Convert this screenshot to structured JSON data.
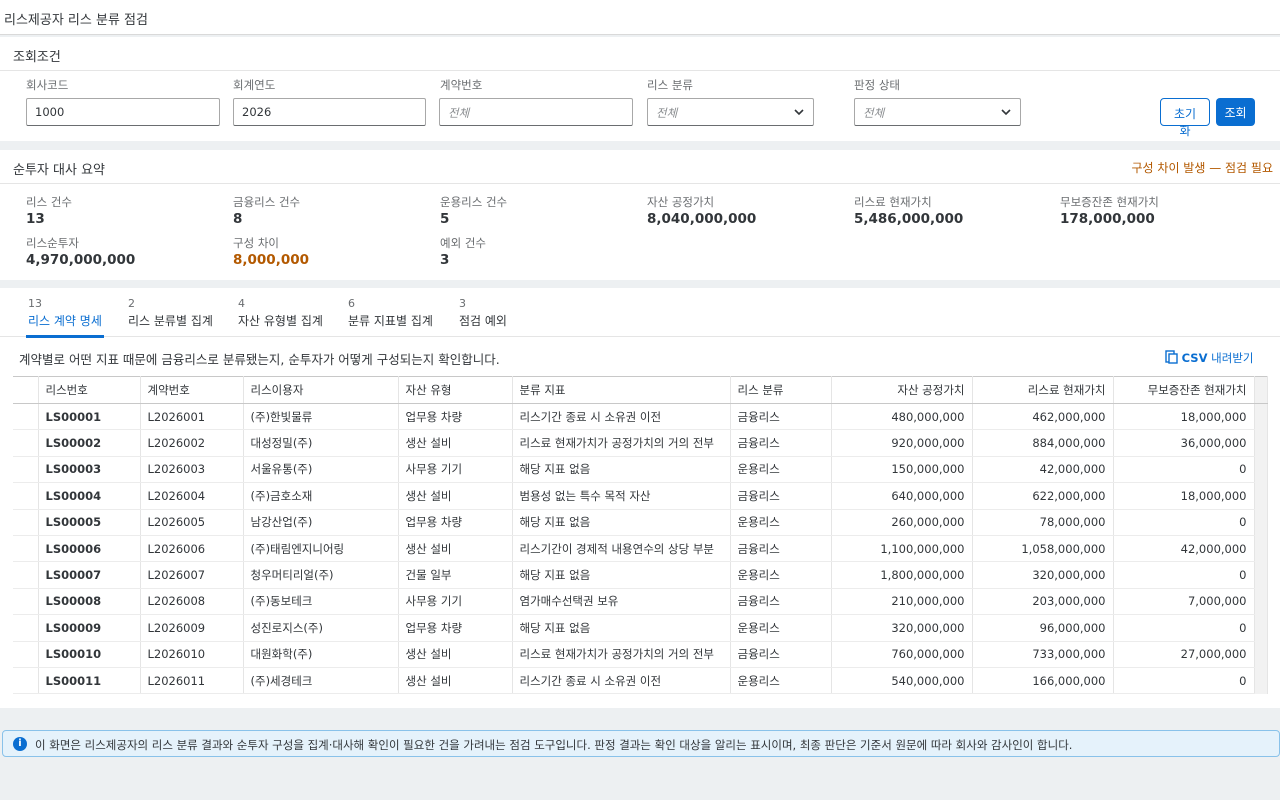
{
  "app": {
    "title": "리스제공자 리스 분류 점검"
  },
  "filters": {
    "section_title": "조회조건",
    "company_code": {
      "label": "회사코드",
      "value": "1000"
    },
    "fiscal_year": {
      "label": "회계연도",
      "value": "2026"
    },
    "contract_no": {
      "label": "계약번호",
      "placeholder": "전체"
    },
    "lease_class": {
      "label": "리스 분류",
      "value": "전체"
    },
    "judgment_status": {
      "label": "판정 상태",
      "value": "전체"
    },
    "reset_label": "초기화",
    "search_label": "조회"
  },
  "summary": {
    "title": "순투자 대사 요약",
    "alert": "구성 차이 발생 — 점검 필요",
    "items": [
      {
        "label": "리스 건수",
        "value": "13"
      },
      {
        "label": "금융리스 건수",
        "value": "8"
      },
      {
        "label": "운용리스 건수",
        "value": "5"
      },
      {
        "label": "자산 공정가치",
        "value": "8,040,000,000"
      },
      {
        "label": "리스료 현재가치",
        "value": "5,486,000,000"
      },
      {
        "label": "무보증잔존 현재가치",
        "value": "178,000,000"
      },
      {
        "label": "리스순투자",
        "value": "4,970,000,000"
      },
      {
        "label": "구성 차이",
        "value": "8,000,000"
      },
      {
        "label": "예외 건수",
        "value": "3"
      }
    ],
    "warn_color": "#b35900"
  },
  "tabs": [
    {
      "count": "13",
      "label": "리스 계약 명세"
    },
    {
      "count": "2",
      "label": "리스 분류별 집계"
    },
    {
      "count": "4",
      "label": "자산 유형별 집계"
    },
    {
      "count": "6",
      "label": "분류 지표별 집계"
    },
    {
      "count": "3",
      "label": "점검 예외"
    }
  ],
  "table": {
    "description": "계약별로 어떤 지표 때문에 금융리스로 분류됐는지, 순투자가 어떻게 구성되는지 확인합니다.",
    "csv_label": "CSV 내려받기",
    "headers": [
      "리스번호",
      "계약번호",
      "리스이용자",
      "자산 유형",
      "분류 지표",
      "리스 분류",
      "자산 공정가치",
      "리스료 현재가치",
      "무보증잔존 현재가치"
    ],
    "rows": [
      [
        "LS00001",
        "L2026001",
        "(주)한빛물류",
        "업무용 차량",
        "리스기간 종료 시 소유권 이전",
        "금융리스",
        "480,000,000",
        "462,000,000",
        "18,000,000"
      ],
      [
        "LS00002",
        "L2026002",
        "대성정밀(주)",
        "생산 설비",
        "리스료 현재가치가 공정가치의 거의 전부",
        "금융리스",
        "920,000,000",
        "884,000,000",
        "36,000,000"
      ],
      [
        "LS00003",
        "L2026003",
        "서울유통(주)",
        "사무용 기기",
        "해당 지표 없음",
        "운용리스",
        "150,000,000",
        "42,000,000",
        "0"
      ],
      [
        "LS00004",
        "L2026004",
        "(주)금호소재",
        "생산 설비",
        "범용성 없는 특수 목적 자산",
        "금융리스",
        "640,000,000",
        "622,000,000",
        "18,000,000"
      ],
      [
        "LS00005",
        "L2026005",
        "남강산업(주)",
        "업무용 차량",
        "해당 지표 없음",
        "운용리스",
        "260,000,000",
        "78,000,000",
        "0"
      ],
      [
        "LS00006",
        "L2026006",
        "(주)태림엔지니어링",
        "생산 설비",
        "리스기간이 경제적 내용연수의 상당 부분",
        "금융리스",
        "1,100,000,000",
        "1,058,000,000",
        "42,000,000"
      ],
      [
        "LS00007",
        "L2026007",
        "청우머티리얼(주)",
        "건물 일부",
        "해당 지표 없음",
        "운용리스",
        "1,800,000,000",
        "320,000,000",
        "0"
      ],
      [
        "LS00008",
        "L2026008",
        "(주)동보테크",
        "사무용 기기",
        "염가매수선택권 보유",
        "금융리스",
        "210,000,000",
        "203,000,000",
        "7,000,000"
      ],
      [
        "LS00009",
        "L2026009",
        "성진로지스(주)",
        "업무용 차량",
        "해당 지표 없음",
        "운용리스",
        "320,000,000",
        "96,000,000",
        "0"
      ],
      [
        "LS00010",
        "L2026010",
        "대원화학(주)",
        "생산 설비",
        "리스료 현재가치가 공정가치의 거의 전부",
        "금융리스",
        "760,000,000",
        "733,000,000",
        "27,000,000"
      ],
      [
        "LS00011",
        "L2026011",
        "(주)세경테크",
        "생산 설비",
        "리스기간 종료 시 소유권 이전",
        "운용리스",
        "540,000,000",
        "166,000,000",
        "0"
      ]
    ]
  },
  "footer": {
    "note": "이 화면은 리스제공자의 리스 분류 결과와 순투자 구성을 집계·대사해 확인이 필요한 건을 가려내는 점검 도구입니다. 판정 결과는 확인 대상을 알리는 표시이며, 최종 판단은 기준서 원문에 따라 회사와 감사인이 합니다."
  },
  "colors": {
    "accent": "#0a6ed1",
    "warning": "#b35900",
    "info_bg": "#e5f2fb"
  }
}
